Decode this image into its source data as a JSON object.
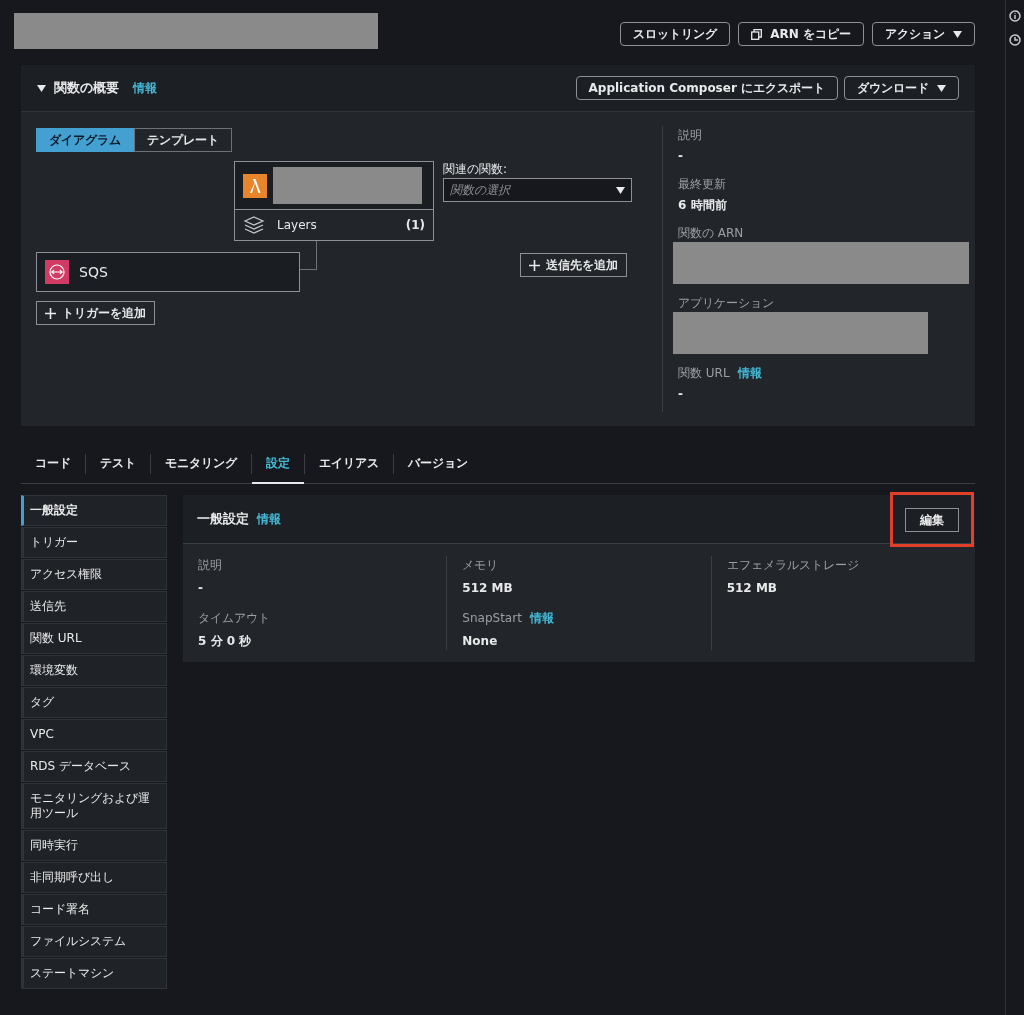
{
  "header_buttons": [
    {
      "label": "スロットリング",
      "kind": "plain"
    },
    {
      "label": "ARN をコピー",
      "kind": "copy"
    },
    {
      "label": "アクション",
      "kind": "dropdown"
    }
  ],
  "overview": {
    "title": "関数の概要",
    "info": "情報",
    "expanded": true,
    "buttons": [
      {
        "label": "Application Composer にエクスポート",
        "kind": "plain"
      },
      {
        "label": "ダウンロード",
        "kind": "dropdown"
      }
    ],
    "view_toggle": [
      {
        "label": "ダイアグラム",
        "selected": true
      },
      {
        "label": "テンプレート",
        "selected": false
      }
    ],
    "layers": {
      "label": "Layers",
      "count": "(1)"
    },
    "related": {
      "label": "関連の関数:",
      "placeholder": "関数の選択"
    },
    "trigger": {
      "label": "SQS"
    },
    "add_trigger": "トリガーを追加",
    "add_destination": "送信先を追加",
    "details": [
      {
        "label": "説明",
        "value": "-"
      },
      {
        "label": "最終更新",
        "value": "6 時間前"
      },
      {
        "label": "関数の ARN",
        "redacted": true
      },
      {
        "label": "アプリケーション",
        "redacted": true
      },
      {
        "label": "関数 URL",
        "info": "情報",
        "value": "-"
      }
    ]
  },
  "tabs": [
    {
      "label": "コード",
      "selected": false
    },
    {
      "label": "テスト",
      "selected": false
    },
    {
      "label": "モニタリング",
      "selected": false
    },
    {
      "label": "設定",
      "selected": true
    },
    {
      "label": "エイリアス",
      "selected": false
    },
    {
      "label": "バージョン",
      "selected": false
    }
  ],
  "sidebar": {
    "items": [
      {
        "label": "一般設定",
        "selected": true
      },
      {
        "label": "トリガー",
        "selected": false
      },
      {
        "label": "アクセス権限",
        "selected": false
      },
      {
        "label": "送信先",
        "selected": false
      },
      {
        "label": "関数 URL",
        "selected": false
      },
      {
        "label": "環境変数",
        "selected": false
      },
      {
        "label": "タグ",
        "selected": false
      },
      {
        "label": "VPC",
        "selected": false
      },
      {
        "label": "RDS データベース",
        "selected": false
      },
      {
        "label": "モニタリングおよび運用ツール",
        "selected": false
      },
      {
        "label": "同時実行",
        "selected": false
      },
      {
        "label": "非同期呼び出し",
        "selected": false
      },
      {
        "label": "コード署名",
        "selected": false
      },
      {
        "label": "ファイルシステム",
        "selected": false
      },
      {
        "label": "ステートマシン",
        "selected": false
      }
    ]
  },
  "general": {
    "title": "一般設定",
    "info": "情報",
    "edit_button": "編集",
    "edit_highlighted": true,
    "columns": [
      [
        {
          "label": "説明",
          "value": "-"
        },
        {
          "label": "タイムアウト",
          "value": "5 分 0 秒"
        }
      ],
      [
        {
          "label": "メモリ",
          "value": "512 MB"
        },
        {
          "label": "SnapStart",
          "info": "情報",
          "value": "None"
        }
      ],
      [
        {
          "label": "エフェメラルストレージ",
          "value": "512 MB"
        }
      ]
    ]
  }
}
